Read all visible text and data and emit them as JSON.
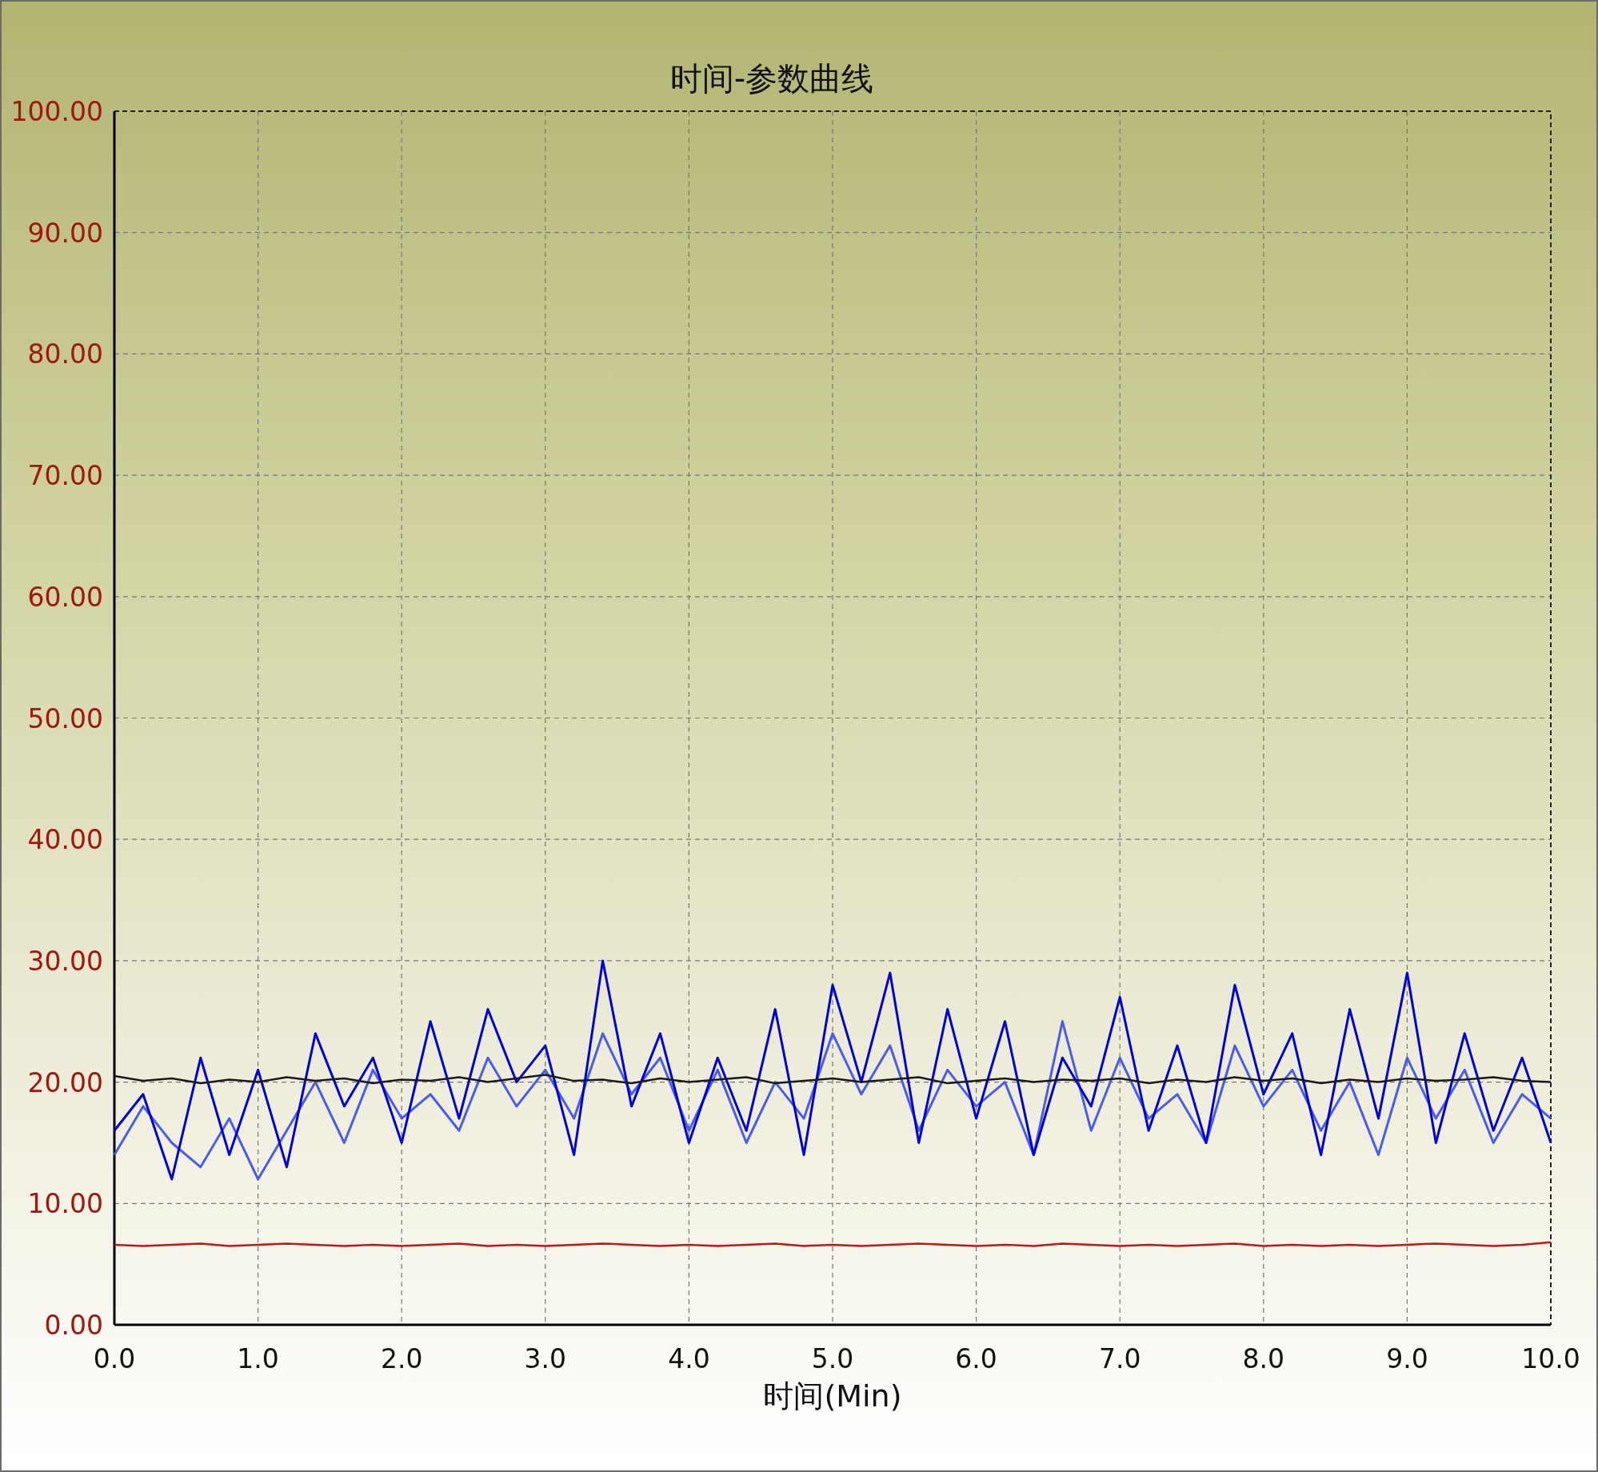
{
  "chart_data": {
    "type": "line",
    "title": "时间-参数曲线",
    "xlabel": "时间(Min)",
    "x": [
      0,
      0.2,
      0.4,
      0.6,
      0.8,
      1,
      1.2,
      1.4,
      1.6,
      1.8,
      2,
      2.2,
      2.4,
      2.6,
      2.8,
      3,
      3.2,
      3.4,
      3.6,
      3.8,
      4,
      4.2,
      4.4,
      4.6,
      4.8,
      5,
      5.2,
      5.4,
      5.6,
      5.8,
      6,
      6.2,
      6.4,
      6.6,
      6.8,
      7,
      7.2,
      7.4,
      7.6,
      7.8,
      8,
      8.2,
      8.4,
      8.6,
      8.8,
      9,
      9.2,
      9.4,
      9.6,
      9.8,
      10
    ],
    "grid": true,
    "xlim": [
      0,
      10
    ],
    "ylim": [
      0,
      100
    ],
    "xticks": [
      {
        "value": 0,
        "label": "0.0"
      },
      {
        "value": 1,
        "label": "1.0"
      },
      {
        "value": 2,
        "label": "2.0"
      },
      {
        "value": 3,
        "label": "3.0"
      },
      {
        "value": 4,
        "label": "4.0"
      },
      {
        "value": 5,
        "label": "5.0"
      },
      {
        "value": 6,
        "label": "6.0"
      },
      {
        "value": 7,
        "label": "7.0"
      },
      {
        "value": 8,
        "label": "8.0"
      },
      {
        "value": 9,
        "label": "9.0"
      },
      {
        "value": 10,
        "label": "10.0"
      }
    ],
    "yticks": [
      {
        "value": 0,
        "label": "0.00"
      },
      {
        "value": 10,
        "label": "10.00"
      },
      {
        "value": 20,
        "label": "20.00"
      },
      {
        "value": 30,
        "label": "30.00"
      },
      {
        "value": 40,
        "label": "40.00"
      },
      {
        "value": 50,
        "label": "50.00"
      },
      {
        "value": 60,
        "label": "60.00"
      },
      {
        "value": 70,
        "label": "70.00"
      },
      {
        "value": 80,
        "label": "80.00"
      },
      {
        "value": 90,
        "label": "90.00"
      },
      {
        "value": 100,
        "label": "100.00"
      }
    ],
    "series": [
      {
        "color": "#4a5cf0",
        "values": [
          14,
          18,
          15,
          13,
          17,
          12,
          16,
          20,
          15,
          21,
          17,
          19,
          16,
          22,
          18,
          21,
          17,
          24,
          19,
          22,
          16,
          21,
          15,
          20,
          17,
          24,
          19,
          23,
          16,
          21,
          18,
          20,
          14,
          25,
          16,
          22,
          17,
          19,
          15,
          23,
          18,
          21,
          16,
          20,
          14,
          22,
          17,
          21,
          15,
          19,
          17
        ]
      },
      {
        "color": "#0000e0",
        "values": [
          16,
          19,
          12,
          22,
          14,
          21,
          13,
          24,
          18,
          22,
          15,
          25,
          17,
          26,
          20,
          23,
          14,
          30,
          18,
          24,
          15,
          22,
          16,
          26,
          14,
          28,
          20,
          29,
          15,
          26,
          17,
          25,
          14,
          22,
          18,
          27,
          16,
          23,
          15,
          28,
          19,
          24,
          14,
          26,
          17,
          29,
          15,
          24,
          16,
          22,
          15
        ]
      },
      {
        "color": "#1a1a1a",
        "values": [
          20.5,
          20.1,
          20.3,
          19.9,
          20.2,
          20.0,
          20.4,
          20.1,
          20.3,
          19.9,
          20.2,
          20.1,
          20.4,
          20.0,
          20.3,
          20.6,
          20.1,
          20.2,
          19.9,
          20.3,
          20.0,
          20.2,
          20.4,
          19.9,
          20.1,
          20.3,
          20.0,
          20.2,
          20.4,
          19.9,
          20.1,
          20.3,
          20.0,
          20.2,
          20.1,
          20.3,
          19.9,
          20.2,
          20.0,
          20.4,
          20.1,
          20.3,
          19.9,
          20.2,
          20.0,
          20.3,
          20.1,
          20.2,
          20.4,
          20.1,
          20.0
        ]
      },
      {
        "color": "#c01818",
        "values": [
          6.6,
          6.5,
          6.6,
          6.7,
          6.5,
          6.6,
          6.7,
          6.6,
          6.5,
          6.6,
          6.5,
          6.6,
          6.7,
          6.5,
          6.6,
          6.5,
          6.6,
          6.7,
          6.6,
          6.5,
          6.6,
          6.5,
          6.6,
          6.7,
          6.5,
          6.6,
          6.5,
          6.6,
          6.7,
          6.6,
          6.5,
          6.6,
          6.5,
          6.7,
          6.6,
          6.5,
          6.6,
          6.5,
          6.6,
          6.7,
          6.5,
          6.6,
          6.5,
          6.6,
          6.5,
          6.6,
          6.7,
          6.6,
          6.5,
          6.6,
          6.8
        ]
      }
    ]
  }
}
